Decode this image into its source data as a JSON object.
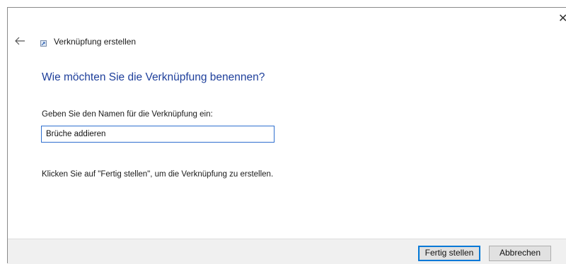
{
  "window": {
    "close_glyph": "✕"
  },
  "header": {
    "back_icon": "arrow-left-icon",
    "app_icon": "shortcut-icon",
    "title": "Verknüpfung erstellen"
  },
  "main": {
    "heading": "Wie möchten Sie die Verknüpfung benennen?",
    "name_label": "Geben Sie den Namen für die Verknüpfung ein:",
    "name_value": "Brüche addieren",
    "instruction": "Klicken Sie auf \"Fertig stellen\", um die Verknüpfung zu erstellen."
  },
  "footer": {
    "finish_label": "Fertig stellen",
    "cancel_label": "Abbrechen"
  },
  "colors": {
    "heading": "#1e3f9b",
    "input_border": "#2f6fcf",
    "default_button_border": "#0078d7",
    "footer_bg": "#f0f0f0"
  }
}
